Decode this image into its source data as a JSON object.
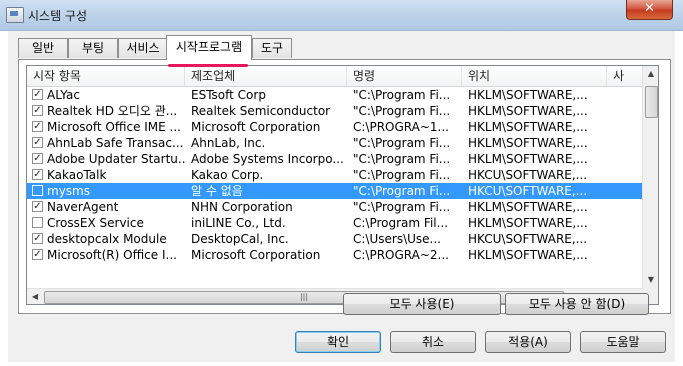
{
  "window": {
    "title": "시스템 구성",
    "close_glyph": "✕"
  },
  "tabs": [
    {
      "label": "일반"
    },
    {
      "label": "부팅"
    },
    {
      "label": "서비스"
    },
    {
      "label": "시작프로그램",
      "active": true
    },
    {
      "label": "도구"
    }
  ],
  "columns": [
    {
      "label": "시작 항목"
    },
    {
      "label": "제조업체"
    },
    {
      "label": "명령"
    },
    {
      "label": "위치"
    },
    {
      "label": "사"
    }
  ],
  "rows": [
    {
      "checked": true,
      "item": "ALYac",
      "manufacturer": "ESTsoft Corp",
      "command": "\"C:\\Program Fi...",
      "location": "HKLM\\SOFTWARE,..."
    },
    {
      "checked": true,
      "item": "Realtek HD 오디오 관...",
      "manufacturer": "Realtek Semiconductor",
      "command": "\"C:\\Program Fi...",
      "location": "HKLM\\SOFTWARE,..."
    },
    {
      "checked": true,
      "item": "Microsoft Office IME ...",
      "manufacturer": "Microsoft Corporation",
      "command": "C:\\PROGRA~1...",
      "location": "HKLM\\SOFTWARE,..."
    },
    {
      "checked": true,
      "item": "AhnLab Safe Transac...",
      "manufacturer": "AhnLab, Inc.",
      "command": "\"C:\\Program Fi...",
      "location": "HKLM\\SOFTWARE,..."
    },
    {
      "checked": true,
      "item": "Adobe Updater Startu...",
      "manufacturer": "Adobe Systems Incorpo...",
      "command": "\"C:\\Program Fi...",
      "location": "HKLM\\SOFTWARE,..."
    },
    {
      "checked": true,
      "item": "KakaoTalk",
      "manufacturer": "Kakao Corp.",
      "command": "\"C:\\Program Fi...",
      "location": "HKCU\\SOFTWARE,..."
    },
    {
      "checked": false,
      "item": "mysms",
      "manufacturer": "알 수 없음",
      "command": "\"C:\\Program Fi...",
      "location": "HKCU\\SOFTWARE,...",
      "selected": true
    },
    {
      "checked": true,
      "item": "NaverAgent",
      "manufacturer": "NHN Corporation",
      "command": "\"C:\\Program Fi...",
      "location": "HKLM\\SOFTWARE,..."
    },
    {
      "checked": false,
      "item": "CrossEX Service",
      "manufacturer": "iniLINE Co., Ltd.",
      "command": "C:\\Program Fil...",
      "location": "HKLM\\SOFTWARE,..."
    },
    {
      "checked": true,
      "item": "desktopcalx Module",
      "manufacturer": "DesktopCal, Inc.",
      "command": "C:\\Users\\Use...",
      "location": "HKCU\\SOFTWARE,..."
    },
    {
      "checked": true,
      "item": "Microsoft(R) Office I...",
      "manufacturer": "Microsoft Corporation",
      "command": "C:\\PROGRA~2...",
      "location": "HKLM\\SOFTWARE,..."
    }
  ],
  "check_glyph": "✓",
  "scrollbar": {
    "thumb_grip": "|||"
  },
  "actions": {
    "enable_all": "모두 사용(E)",
    "disable_all": "모두 사용 안 함(D)"
  },
  "footer": {
    "ok": "확인",
    "cancel": "취소",
    "apply": "적용(A)",
    "help": "도움말"
  },
  "colors": {
    "selection": "#3399ff",
    "tab_underline": "#e8175d",
    "close_button": "#c33a20"
  }
}
